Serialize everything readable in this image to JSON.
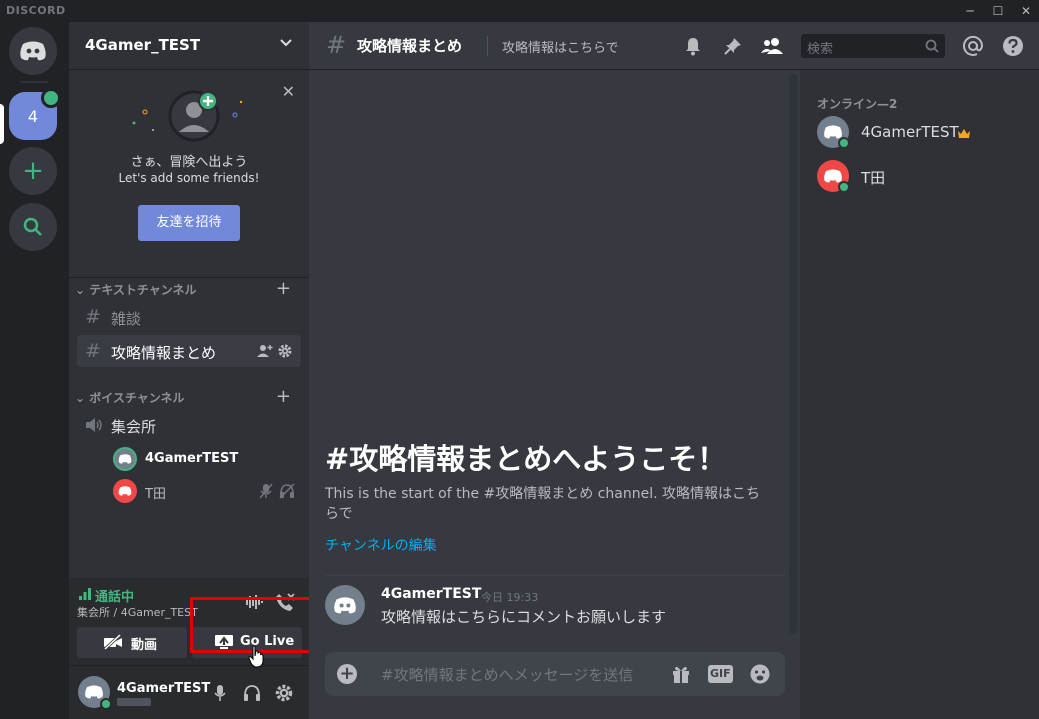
{
  "titlebar": {
    "brand": "DISCORD",
    "minimize": "─",
    "maximize": "☐",
    "close": "✕"
  },
  "rail": {
    "server_badge": "4"
  },
  "server": {
    "name": "4Gamer_TEST"
  },
  "invite": {
    "line1": "さぁ、冒険へ出よう",
    "line2": "Let's add some friends!",
    "button": "友達を招待"
  },
  "text_category": "テキストチャンネル",
  "text_channels": [
    {
      "name": "雑談"
    },
    {
      "name": "攻略情報まとめ"
    }
  ],
  "voice_category": "ボイスチャンネル",
  "voice_channel": {
    "name": "集会所"
  },
  "voice_users": [
    {
      "name": "4GamerTEST",
      "color": "#43b581"
    },
    {
      "name": "T田",
      "color": "#f04747"
    }
  ],
  "voice_panel": {
    "status": "通話中",
    "location": "集会所 / 4Gamer_TEST",
    "video_label": "動画",
    "golive_label": "Go Live"
  },
  "user_panel": {
    "name": "4GamerTEST"
  },
  "chat": {
    "channel_title": "攻略情報まとめ",
    "topic": "攻略情報はこちらで",
    "search_placeholder": "検索",
    "welcome_title": "#攻略情報まとめへようこそ！",
    "welcome_desc": "This is the start of the #攻略情報まとめ channel. 攻略情報はこちらで",
    "edit_link": "チャンネルの編集",
    "message": {
      "author": "4GamerTEST",
      "time": "今日 19:33",
      "text": "攻略情報はこちらにコメントお願いします"
    },
    "composer_placeholder": "#攻略情報まとめへメッセージを送信"
  },
  "members": {
    "heading": "オンライン—2",
    "list": [
      {
        "name": "4GamerTEST",
        "owner": true,
        "color": "#747f8d"
      },
      {
        "name": "T田",
        "owner": false,
        "color": "#f04747"
      }
    ]
  },
  "colors": {
    "accent": "#7289da",
    "online": "#43b581",
    "highlight": "#e50000",
    "link": "#00b0f4"
  }
}
